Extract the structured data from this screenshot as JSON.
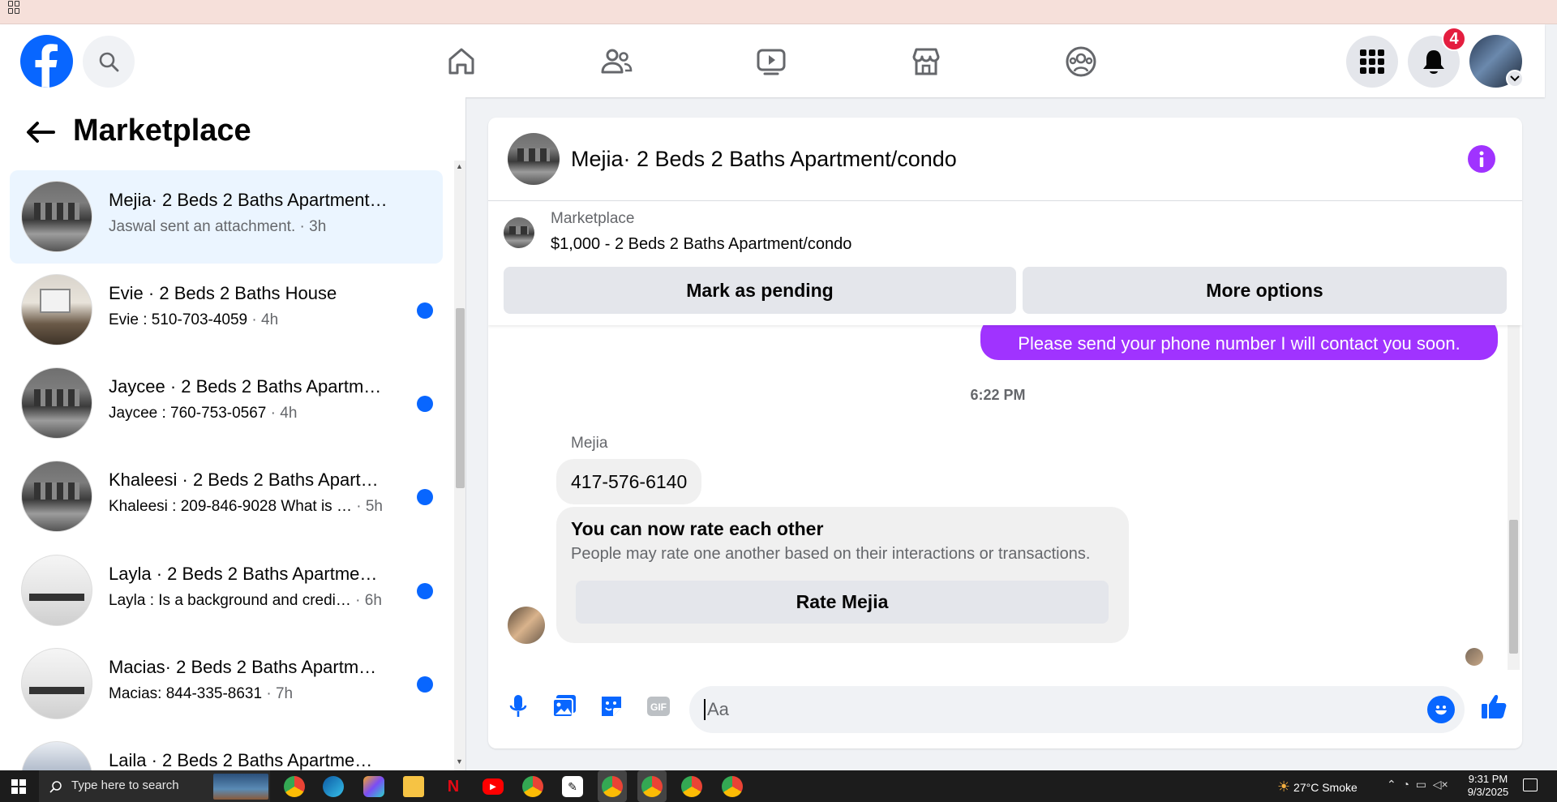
{
  "header": {
    "notification_count": "4",
    "brand_color": "#0866ff"
  },
  "left_panel": {
    "title": "Marketplace",
    "conversations": [
      {
        "title": "Mejia· 2 Beds 2 Baths Apartment…",
        "snippet": "Jaswal sent an attachment.",
        "time": " · 3h",
        "unread": false,
        "active": true
      },
      {
        "title": "Evie · 2 Beds 2 Baths House",
        "snippet": "Evie : 510-703-4059",
        "time": " · 4h",
        "unread": true,
        "active": false
      },
      {
        "title": "Jaycee · 2 Beds 2 Baths Apartm…",
        "snippet": "Jaycee : 760-753-0567",
        "time": " · 4h",
        "unread": true,
        "active": false
      },
      {
        "title": "Khaleesi · 2 Beds 2 Baths Apart…",
        "snippet": "Khaleesi : 209-846-9028 What is …",
        "time": " · 5h",
        "unread": true,
        "active": false
      },
      {
        "title": "Layla · 2 Beds 2 Baths Apartme…",
        "snippet": "Layla : Is a background and credi…",
        "time": " · 6h",
        "unread": true,
        "active": false
      },
      {
        "title": "Macias· 2 Beds 2 Baths Apartm…",
        "snippet": "Macias: 844-335-8631",
        "time": " · 7h",
        "unread": true,
        "active": false
      },
      {
        "title": "Laila · 2 Beds 2 Baths Apartme…",
        "snippet": "",
        "time": "",
        "unread": false,
        "active": false
      }
    ]
  },
  "chat": {
    "title": "Mejia· 2 Beds 2 Baths Apartment/condo",
    "listing": {
      "source": "Marketplace",
      "description": "$1,000 - 2 Beds 2 Baths Apartment/condo"
    },
    "buttons": {
      "mark_pending": "Mark as pending",
      "more_options": "More options"
    },
    "outgoing_message": "Please send your phone number I will contact you soon.",
    "timestamp": "6:22 PM",
    "sender_name": "Mejia",
    "incoming_message": "417-576-6140",
    "rate_card": {
      "title": "You can now rate each other",
      "subtitle": "People may rate one another based on their interactions or transactions.",
      "button": "Rate Mejia"
    },
    "composer_placeholder": "Aa",
    "accent_color": "#a033ff"
  },
  "taskbar": {
    "search_placeholder": "Type here to search",
    "weather": "27°C  Smoke",
    "time": "9:31 PM",
    "date": "9/3/2025"
  }
}
